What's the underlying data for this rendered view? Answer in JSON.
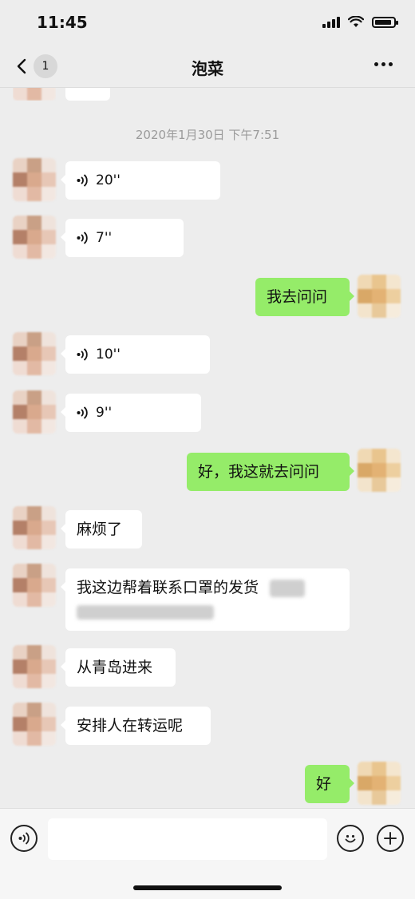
{
  "status_bar": {
    "time": "11:45"
  },
  "nav": {
    "back_badge": "1",
    "title": "泡菜"
  },
  "chat": {
    "timestamp": "2020年1月30日 下午7:51",
    "messages": [
      {
        "from": "friend",
        "type": "voice",
        "duration": "20''"
      },
      {
        "from": "friend",
        "type": "voice",
        "duration": "7''"
      },
      {
        "from": "me",
        "type": "text",
        "text": "我去问问"
      },
      {
        "from": "friend",
        "type": "voice",
        "duration": "10''"
      },
      {
        "from": "friend",
        "type": "voice",
        "duration": "9''"
      },
      {
        "from": "me",
        "type": "text",
        "text": "好，我这就去问问"
      },
      {
        "from": "friend",
        "type": "text",
        "text": "麻烦了"
      },
      {
        "from": "friend",
        "type": "text",
        "text": "我这边帮着联系口罩的发货"
      },
      {
        "from": "friend",
        "type": "text",
        "text": "从青岛进来"
      },
      {
        "from": "friend",
        "type": "text",
        "text": "安排人在转运呢"
      },
      {
        "from": "me",
        "type": "text",
        "text": "好"
      }
    ]
  },
  "colors": {
    "background": "#ededed",
    "outgoing_bubble": "#95ec69",
    "incoming_bubble": "#ffffff",
    "timestamp": "#9b9b9b"
  },
  "icons": [
    "back-chevron-icon",
    "more-dots-icon",
    "voice-wave-icon",
    "voice-input-icon",
    "emoji-icon",
    "plus-icon",
    "wifi-icon",
    "signal-icon",
    "battery-icon"
  ]
}
